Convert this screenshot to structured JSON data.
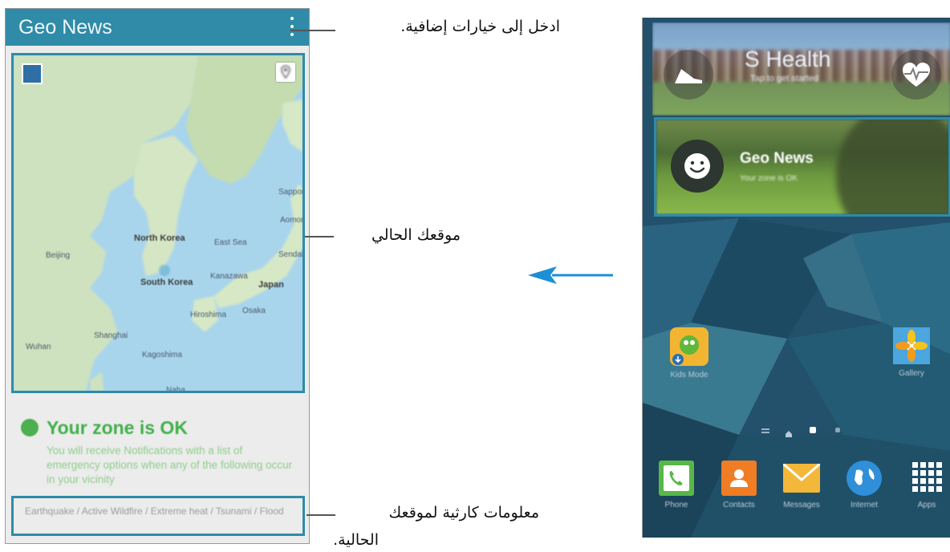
{
  "geo_news": {
    "title": "Geo News",
    "map_labels": [
      {
        "id": "north-korea",
        "text": "North Korea",
        "style": "big"
      },
      {
        "id": "south-korea",
        "text": "South Korea",
        "style": "big"
      },
      {
        "id": "japan",
        "text": "Japan",
        "style": "big"
      },
      {
        "id": "east-sea",
        "text": "East Sea",
        "style": "small"
      },
      {
        "id": "beijing",
        "text": "Beijing",
        "style": "small"
      },
      {
        "id": "shanghai",
        "text": "Shanghai",
        "style": "small"
      },
      {
        "id": "wuhan",
        "text": "Wuhan",
        "style": "small"
      },
      {
        "id": "kagoshima",
        "text": "Kagoshima",
        "style": "small"
      },
      {
        "id": "naha",
        "text": "Naha",
        "style": "small"
      },
      {
        "id": "kanazawa",
        "text": "Kanazawa",
        "style": "small"
      },
      {
        "id": "hiroshima",
        "text": "Hiroshima",
        "style": "small"
      },
      {
        "id": "osaka",
        "text": "Osaka",
        "style": "small"
      },
      {
        "id": "sendai",
        "text": "Sendai",
        "style": "small"
      },
      {
        "id": "sapporo",
        "text": "Sapporo",
        "style": "small"
      },
      {
        "id": "aomori",
        "text": "Aomori",
        "style": "small"
      }
    ],
    "zone_title": "Your zone is OK",
    "zone_text": "You will receive Notifications with a list of emergency options when any of the following occur in your vicinity",
    "disaster_text": "Earthquake / Active Wildfire / Extreme heat / Tsunami / Flood"
  },
  "callouts": {
    "more_options": "ادخل إلى خيارات إضافية.",
    "current_location": "موقعك الحالي",
    "disaster_info_line1": "معلومات كارثية لموقعك",
    "disaster_info_line2": "الحالية."
  },
  "home": {
    "shealth_title": "S Health",
    "shealth_sub": "Tap to get started",
    "geotile_title": "Geo News",
    "geotile_sub": "Your zone is OK",
    "apps_row": [
      {
        "label": "Kids Mode",
        "color": "#f2b531"
      },
      {
        "label": "Gallery",
        "color": "#f4c21b"
      }
    ],
    "dock": [
      {
        "label": "Phone",
        "color": "#58b847"
      },
      {
        "label": "Contacts",
        "color": "#f07c24"
      },
      {
        "label": "Messages",
        "color": "#f3b73a"
      },
      {
        "label": "Internet",
        "color": "#2f8fd9"
      },
      {
        "label": "Apps",
        "color": "#ffffff"
      }
    ]
  },
  "colors": {
    "accent": "#2f8ba7",
    "arrow": "#1c8fd6",
    "zone_green": "#3fb04a"
  }
}
